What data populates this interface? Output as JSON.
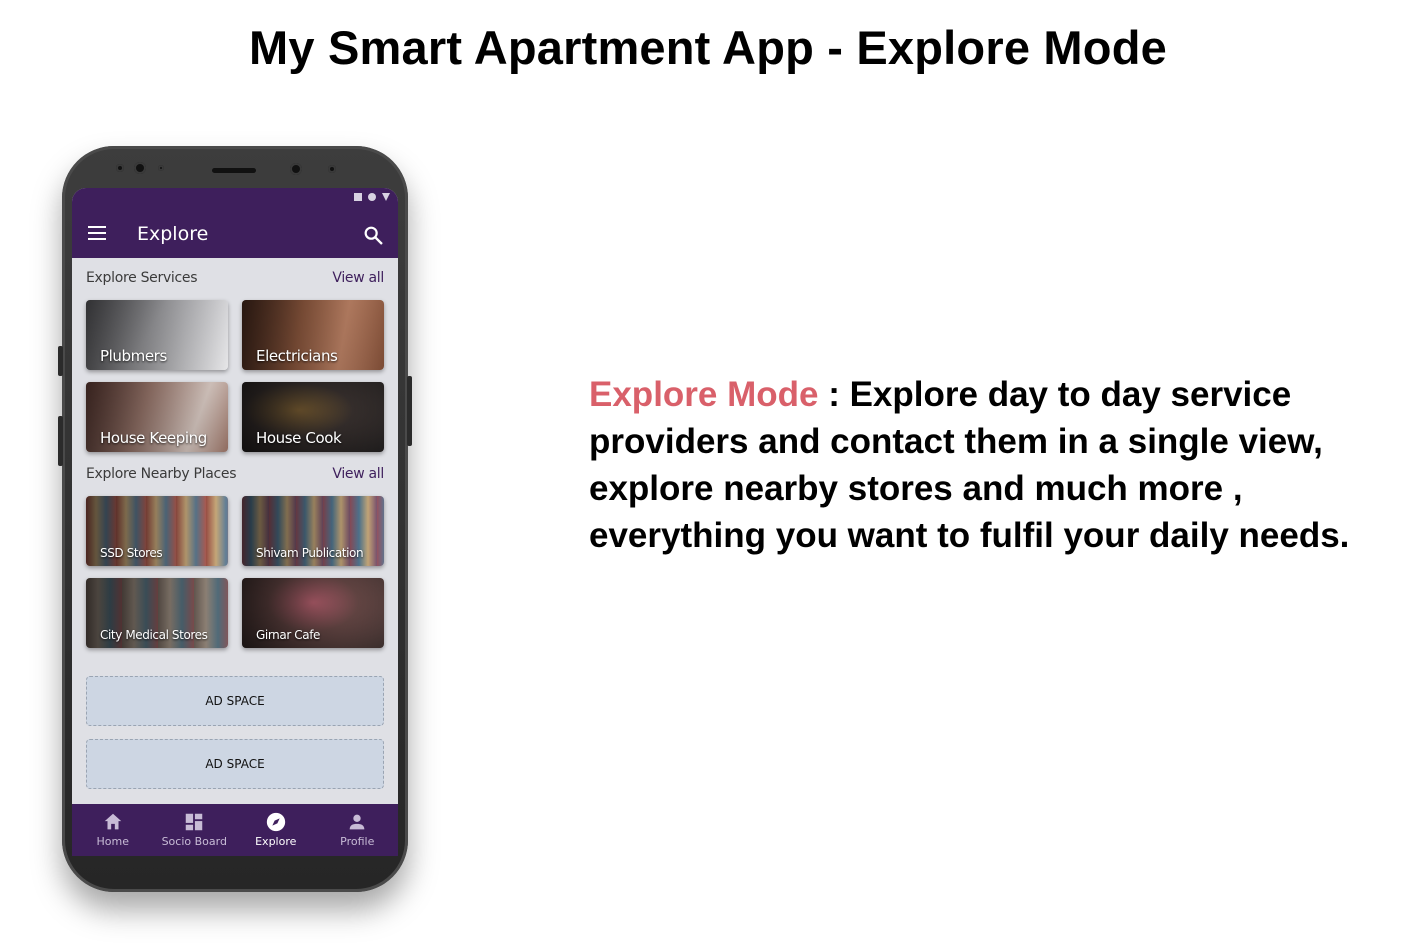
{
  "page": {
    "title": "My Smart Apartment App - Explore Mode"
  },
  "phone": {
    "appbar": {
      "title": "Explore",
      "menu_icon": "menu-icon",
      "search_icon": "search-icon"
    },
    "services": {
      "heading": "Explore Services",
      "view_all": "View all",
      "tiles": [
        {
          "label": "Plubmers",
          "color": "#8f8f94"
        },
        {
          "label": "Electricians",
          "color": "#8a5a3a"
        },
        {
          "label": "House Keeping",
          "color": "#9a7466"
        },
        {
          "label": "House Cook",
          "color": "#3a3532"
        }
      ]
    },
    "nearby": {
      "heading": "Explore Nearby Places",
      "view_all": "View all",
      "tiles": [
        {
          "label": "SSD Stores",
          "color": "#8a4a3c"
        },
        {
          "label": "Shivam Publication",
          "color": "#6b4a52"
        },
        {
          "label": "City Medical Stores",
          "color": "#5e4c44"
        },
        {
          "label": "Girnar Cafe",
          "color": "#6a4a48"
        }
      ]
    },
    "ads": [
      "AD SPACE",
      "AD SPACE"
    ],
    "bottom_nav": [
      {
        "label": "Home",
        "icon": "home-icon",
        "active": false
      },
      {
        "label": "Socio Board",
        "icon": "dashboard-icon",
        "active": false
      },
      {
        "label": "Explore",
        "icon": "compass-icon",
        "active": true
      },
      {
        "label": "Profile",
        "icon": "person-icon",
        "active": false
      }
    ],
    "theme": {
      "primary": "#3e1f5c",
      "background": "#dfe0e5"
    }
  },
  "description": {
    "highlight": "Explore Mode",
    "text": " : Explore day to day service providers and contact them in a single view, explore nearby stores and much more , everything you want to fulfil your daily needs.",
    "highlight_color": "#d9606a"
  }
}
